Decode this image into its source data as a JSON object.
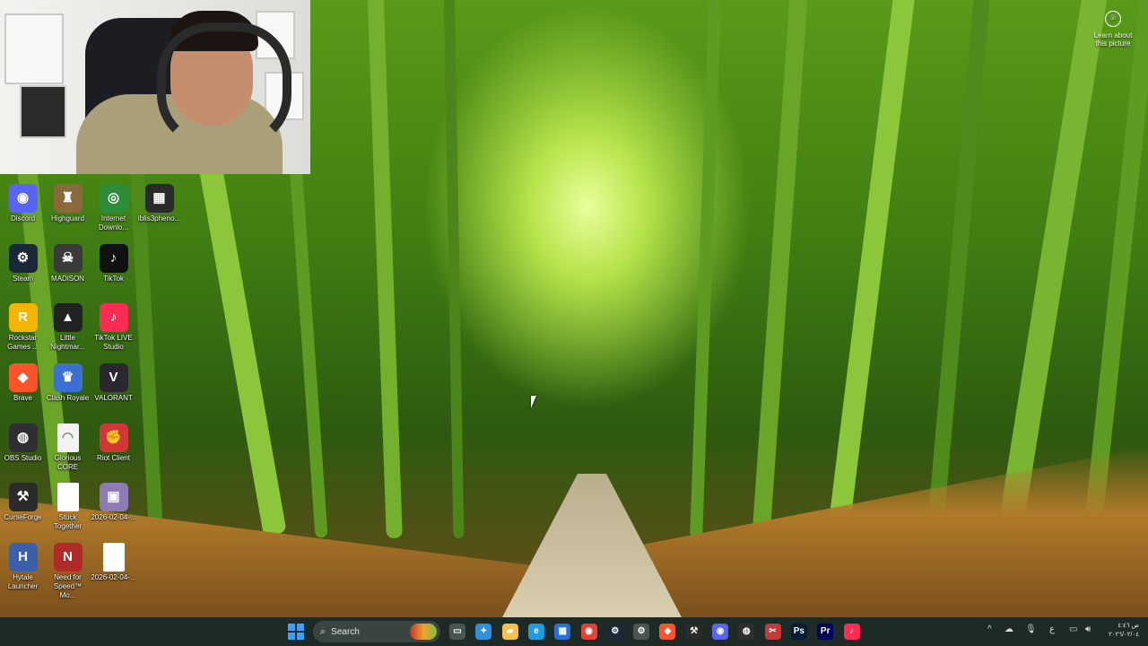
{
  "desktop": {
    "icons": [
      {
        "label": "Discord",
        "icon": "discord-icon",
        "color": "#5865f2",
        "glyph": "◉"
      },
      {
        "label": "Highguard",
        "icon": "highguard-icon",
        "color": "#8a6a3a",
        "glyph": "♜"
      },
      {
        "label": "Internet Downlo...",
        "icon": "internet-download-manager-icon",
        "color": "#2d8c3a",
        "glyph": "◎"
      },
      {
        "label": "iblis3pheno...",
        "icon": "iblis-icon",
        "color": "#2a2a2a",
        "glyph": "▦"
      },
      {
        "label": "Steam",
        "icon": "steam-icon",
        "color": "#1b2838",
        "glyph": "⚙"
      },
      {
        "label": "MADiSON",
        "icon": "madison-icon",
        "color": "#3a3a3a",
        "glyph": "☠"
      },
      {
        "label": "TikTok",
        "icon": "tiktok-icon",
        "color": "#111111",
        "glyph": "♪"
      },
      {
        "label": "Rockstar Games ...",
        "icon": "rockstar-games-icon",
        "color": "#f5b400",
        "glyph": "R"
      },
      {
        "label": "Little Nightmar...",
        "icon": "little-nightmares-icon",
        "color": "#222222",
        "glyph": "▲"
      },
      {
        "label": "TikTok LIVE Studio",
        "icon": "tiktok-live-studio-icon",
        "color": "#fe2c55",
        "glyph": "♪"
      },
      {
        "label": "Brave",
        "icon": "brave-icon",
        "color": "#fb542b",
        "glyph": "◆"
      },
      {
        "label": "Clash Royale",
        "icon": "clash-royale-icon",
        "color": "#3b6fd1",
        "glyph": "♛"
      },
      {
        "label": "VALORANT",
        "icon": "valorant-icon",
        "color": "#2a2730",
        "glyph": "V"
      },
      {
        "label": "OBS Studio",
        "icon": "obs-studio-icon",
        "color": "#302e31",
        "glyph": "◍"
      },
      {
        "label": "Glorious CORE",
        "icon": "glorious-core-icon",
        "color": "#f2f2f2",
        "glyph": "◠"
      },
      {
        "label": "Riot Client",
        "icon": "riot-client-icon",
        "color": "#d13639",
        "glyph": "✊"
      },
      {
        "label": "CurseForge",
        "icon": "curseforge-icon",
        "color": "#2b2b2b",
        "glyph": "⚒"
      },
      {
        "label": "Stuck Together",
        "icon": "file-icon",
        "color": "#ffffff",
        "glyph": ""
      },
      {
        "label": "2026-02-04-...",
        "icon": "image-file-icon",
        "color": "#8e7ab5",
        "glyph": "▣"
      },
      {
        "label": "Hytale Launcher",
        "icon": "hytale-launcher-icon",
        "color": "#3b5fa8",
        "glyph": "H"
      },
      {
        "label": "Need for Speed™ Mo...",
        "icon": "need-for-speed-icon",
        "color": "#b02a2a",
        "glyph": "N"
      },
      {
        "label": "2026-02-04-...",
        "icon": "file-icon",
        "color": "#ffffff",
        "glyph": ""
      }
    ],
    "learn_about": "Learn about this picture"
  },
  "taskbar": {
    "search_placeholder": "Search",
    "apps": [
      {
        "name": "task-view-icon",
        "color": "#4a5550",
        "glyph": "▭"
      },
      {
        "name": "copilot-icon",
        "color": "#2f8fd8",
        "glyph": "✦"
      },
      {
        "name": "file-explorer-icon",
        "color": "#f2c14e",
        "glyph": "▰"
      },
      {
        "name": "edge-icon",
        "color": "#1f9be0",
        "glyph": "e"
      },
      {
        "name": "microsoft-store-icon",
        "color": "#2a6fd6",
        "glyph": "▦"
      },
      {
        "name": "chrome-icon",
        "color": "#e44134",
        "glyph": "◉"
      },
      {
        "name": "steam-icon",
        "color": "#1b2838",
        "glyph": "⚙"
      },
      {
        "name": "settings-icon",
        "color": "#4a5550",
        "glyph": "⚙"
      },
      {
        "name": "brave-icon",
        "color": "#fb542b",
        "glyph": "◆"
      },
      {
        "name": "curseforge-icon",
        "color": "#2b2b2b",
        "glyph": "⚒"
      },
      {
        "name": "discord-icon",
        "color": "#5865f2",
        "glyph": "◉"
      },
      {
        "name": "obs-studio-icon",
        "color": "#302e31",
        "glyph": "◍"
      },
      {
        "name": "snipping-tool-icon",
        "color": "#c23b3b",
        "glyph": "✂"
      },
      {
        "name": "photoshop-icon",
        "color": "#001e36",
        "glyph": "Ps"
      },
      {
        "name": "premiere-icon",
        "color": "#00005b",
        "glyph": "Pr"
      },
      {
        "name": "tiktok-live-studio-icon",
        "color": "#fe2c55",
        "glyph": "♪"
      }
    ],
    "tray": {
      "chevron": "^",
      "lang": "ع",
      "time": "ص ٤:٤٦",
      "date": "٢٠٢٦/٠٢/٠٤"
    }
  }
}
